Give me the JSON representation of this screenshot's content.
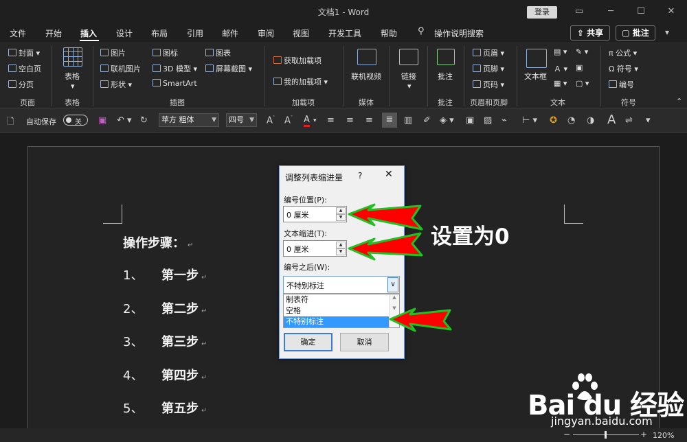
{
  "window": {
    "title": "文档1 - Word",
    "login": "登录"
  },
  "tabs": [
    "文件",
    "开始",
    "插入",
    "设计",
    "布局",
    "引用",
    "邮件",
    "审阅",
    "视图",
    "开发工具",
    "帮助"
  ],
  "active_tab": "插入",
  "tell_me": "操作说明搜索",
  "share": "共享",
  "comments": "批注",
  "ribbon": {
    "pages": {
      "cover": "封面",
      "blank": "空白页",
      "break": "分页",
      "group": "页面"
    },
    "tables": {
      "table": "表格",
      "group": "表格"
    },
    "illustrations": {
      "pictures": "图片",
      "online_pictures": "联机图片",
      "shapes": "形状",
      "icons": "图标",
      "models": "3D 模型",
      "smartart": "SmartArt",
      "chart": "图表",
      "screenshot": "屏幕截图",
      "group": "插图"
    },
    "addins": {
      "get": "获取加载项",
      "my": "我的加载项",
      "group": "加载项"
    },
    "media": {
      "online_video": "联机视频",
      "group": "媒体"
    },
    "links": {
      "link": "链接"
    },
    "comments": {
      "comment": "批注",
      "group": "批注"
    },
    "header_footer": {
      "header": "页眉",
      "footer": "页脚",
      "page_number": "页码",
      "group": "页眉和页脚"
    },
    "text": {
      "textbox": "文本框",
      "group": "文本"
    },
    "symbols": {
      "equation": "公式",
      "symbol": "符号",
      "numbering": "编号",
      "group": "符号"
    }
  },
  "qat": {
    "autosave": "自动保存",
    "autosave_state": "关",
    "font": "苹方 粗体",
    "size": "四号"
  },
  "document": {
    "heading": "操作步骤：",
    "steps": [
      {
        "num": "1、",
        "text": "第一步"
      },
      {
        "num": "2、",
        "text": "第二步"
      },
      {
        "num": "3、",
        "text": "第三步"
      },
      {
        "num": "4、",
        "text": "第四步"
      },
      {
        "num": "5、",
        "text": "第五步"
      }
    ]
  },
  "dialog": {
    "title": "调整列表缩进量",
    "help": "?",
    "number_position_label": "编号位置(P):",
    "number_position_value": "0 厘米",
    "text_indent_label": "文本缩进(T):",
    "text_indent_value": "0 厘米",
    "follow_label": "编号之后(W):",
    "follow_value": "不特别标注",
    "options": [
      "制表符",
      "空格",
      "不特别标注"
    ],
    "ok": "确定",
    "cancel": "取消"
  },
  "annotation": {
    "text": "设置为0",
    "arrow_color": "#ff0000",
    "outline_color": "#22c022"
  },
  "status": {
    "zoom": "120%"
  },
  "watermark": {
    "logo": "Bai du 经验",
    "url": "jingyan.baidu.com"
  }
}
